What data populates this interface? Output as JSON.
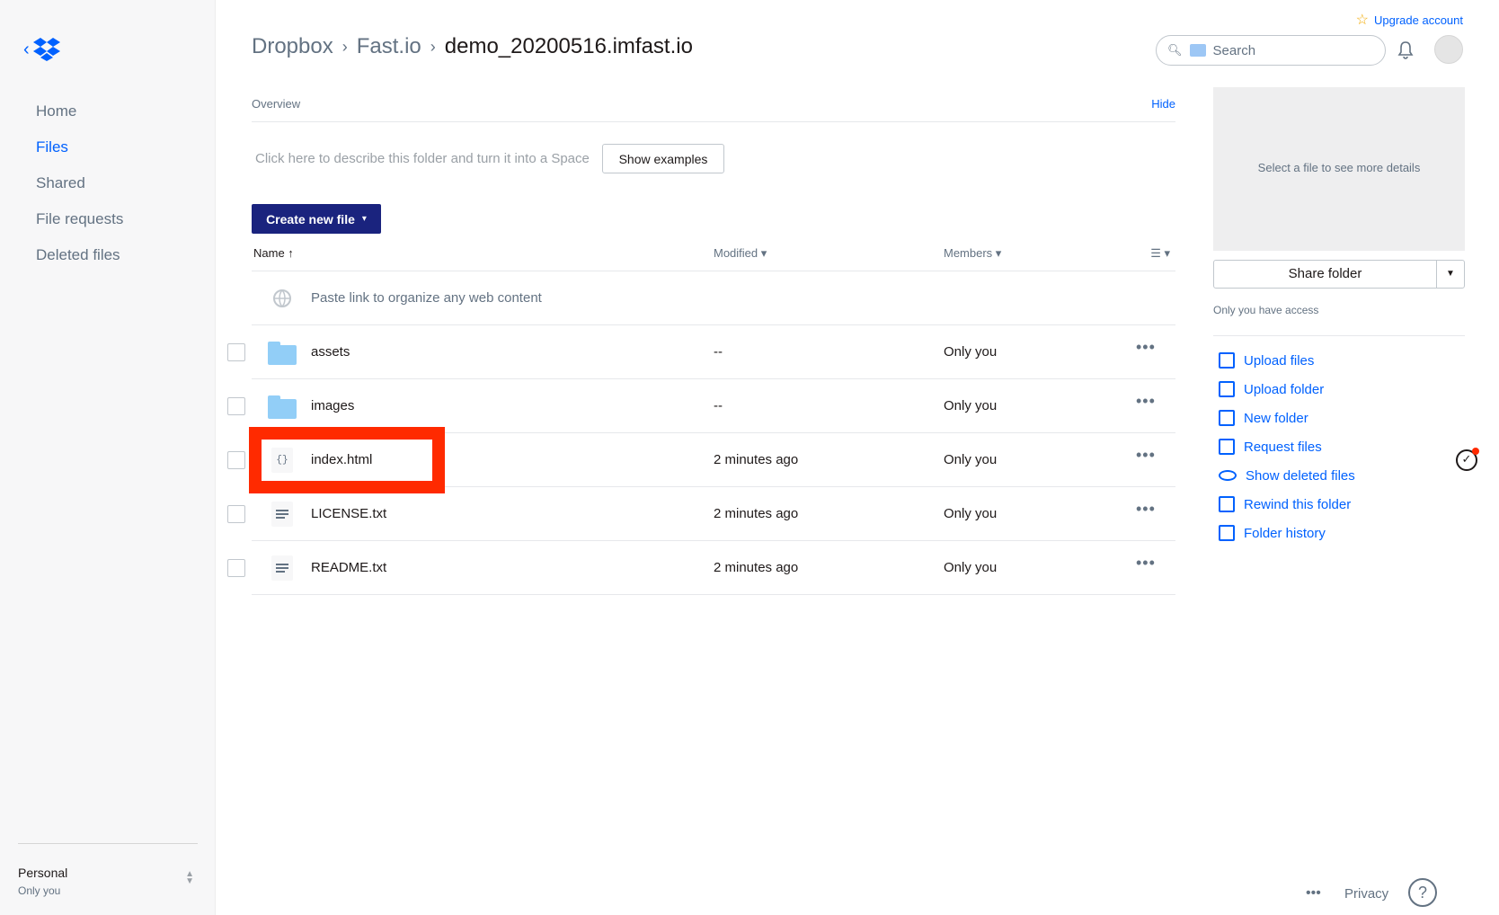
{
  "sidebar": {
    "items": [
      {
        "label": "Home"
      },
      {
        "label": "Files"
      },
      {
        "label": "Shared"
      },
      {
        "label": "File requests"
      },
      {
        "label": "Deleted files"
      }
    ],
    "active": "Files",
    "account": {
      "name": "Personal",
      "sub": "Only you"
    }
  },
  "header": {
    "breadcrumb": [
      "Dropbox",
      "Fast.io",
      "demo_20200516.imfast.io"
    ],
    "upgrade_label": "Upgrade account",
    "search_placeholder": "Search"
  },
  "overview": {
    "label": "Overview",
    "hide_label": "Hide",
    "describe_text": "Click here to describe this folder and turn it into a Space",
    "show_examples_label": "Show examples"
  },
  "create_label": "Create new file",
  "table": {
    "headers": {
      "name": "Name",
      "modified": "Modified",
      "members": "Members"
    },
    "paste_row": "Paste link to organize any web content",
    "rows": [
      {
        "name": "assets",
        "modified": "--",
        "members": "Only you",
        "icon": "folder-icon"
      },
      {
        "name": "images",
        "modified": "--",
        "members": "Only you",
        "icon": "folder-icon"
      },
      {
        "name": "index.html",
        "modified": "2 minutes ago",
        "members": "Only you",
        "icon": "code-file-icon"
      },
      {
        "name": "LICENSE.txt",
        "modified": "2 minutes ago",
        "members": "Only you",
        "icon": "text-file-icon"
      },
      {
        "name": "README.txt",
        "modified": "2 minutes ago",
        "members": "Only you",
        "icon": "text-file-icon"
      }
    ],
    "more_label": "•••"
  },
  "panel": {
    "details_text": "Select a file to see more details",
    "share_label": "Share folder",
    "access_text": "Only you have access",
    "actions": [
      {
        "label": "Upload files",
        "icon": "upload-files-icon"
      },
      {
        "label": "Upload folder",
        "icon": "upload-folder-icon"
      },
      {
        "label": "New folder",
        "icon": "new-folder-icon"
      },
      {
        "label": "Request files",
        "icon": "request-files-icon"
      },
      {
        "label": "Show deleted files",
        "icon": "eye-icon"
      },
      {
        "label": "Rewind this folder",
        "icon": "rewind-icon"
      },
      {
        "label": "Folder history",
        "icon": "history-icon"
      }
    ]
  },
  "footer": {
    "more": "•••",
    "privacy": "Privacy",
    "help": "?"
  },
  "colors": {
    "accent": "#0061fe",
    "create_button": "#1a237e",
    "highlight": "#ff2a00",
    "folder": "#92cef7"
  }
}
